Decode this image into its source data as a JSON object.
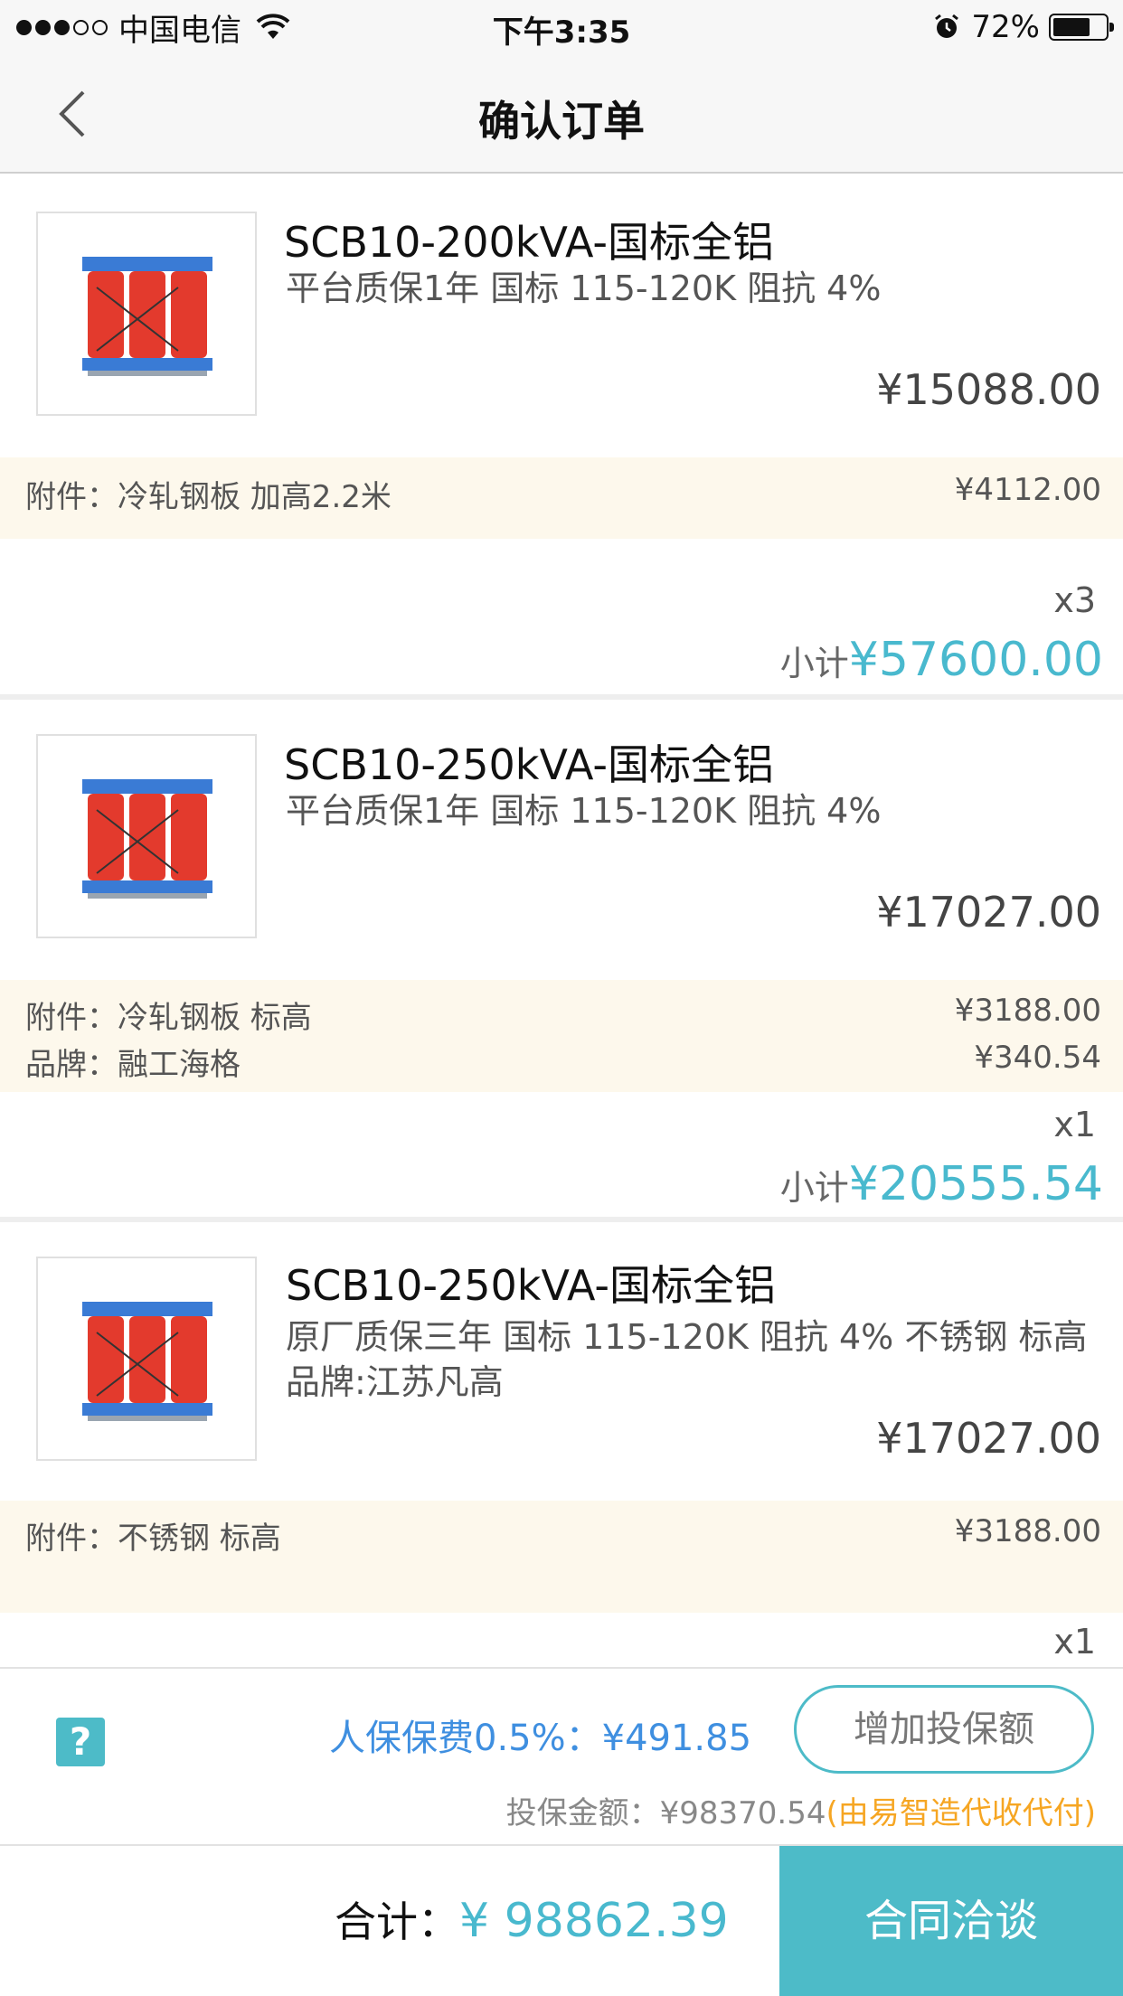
{
  "status_bar": {
    "carrier": "中国电信",
    "time": "下午3:35",
    "battery": "72%",
    "signal_bars_filled": 3,
    "signal_bars_total": 5,
    "battery_level": 0.72
  },
  "nav": {
    "title": "确认订单",
    "back_icon": "chevron-left-icon"
  },
  "products": [
    {
      "name": "SCB10-200kVA-国标全铝",
      "desc": "平台质保1年 国标 115-120K 阻抗 4%",
      "price": "¥15088.00",
      "accessories": [
        {
          "label": "附件：冷轧钢板 加高2.2米",
          "price": "¥4112.00"
        }
      ],
      "qty": "x3",
      "subtotal_label": "小计",
      "subtotal": "¥57600.00"
    },
    {
      "name": "SCB10-250kVA-国标全铝",
      "desc": "平台质保1年 国标 115-120K 阻抗 4%",
      "price": "¥17027.00",
      "accessories": [
        {
          "label": "附件：冷轧钢板 标高",
          "price": "¥3188.00"
        },
        {
          "label": "品牌：融工海格",
          "price": "¥340.54"
        }
      ],
      "qty": "x1",
      "subtotal_label": "小计",
      "subtotal": "¥20555.54"
    },
    {
      "name": "SCB10-250kVA-国标全铝",
      "desc": "原厂质保三年 国标 115-120K 阻抗 4% 不锈钢 标高 品牌:江苏凡高",
      "price": "¥17027.00",
      "accessories": [
        {
          "label": "附件：不锈钢 标高",
          "price": "¥3188.00"
        }
      ],
      "qty": "x1"
    }
  ],
  "insurance": {
    "help_icon": "question-icon",
    "help_text": "?",
    "fee": "人保保费0.5%：¥491.85",
    "add_button": "增加投保额",
    "amount": "投保金额：¥98370.54",
    "note": "(由易智造代收代付)"
  },
  "footer": {
    "total_label": "合计：",
    "total_value": "¥ 98862.39",
    "contract_button": "合同洽谈"
  },
  "colors": {
    "accent": "#4dbbc8",
    "price_blue": "#49b9ce",
    "fee_blue": "#3f8fe0",
    "note_orange": "#f6a623",
    "accessory_bg": "#fdf8ec"
  }
}
